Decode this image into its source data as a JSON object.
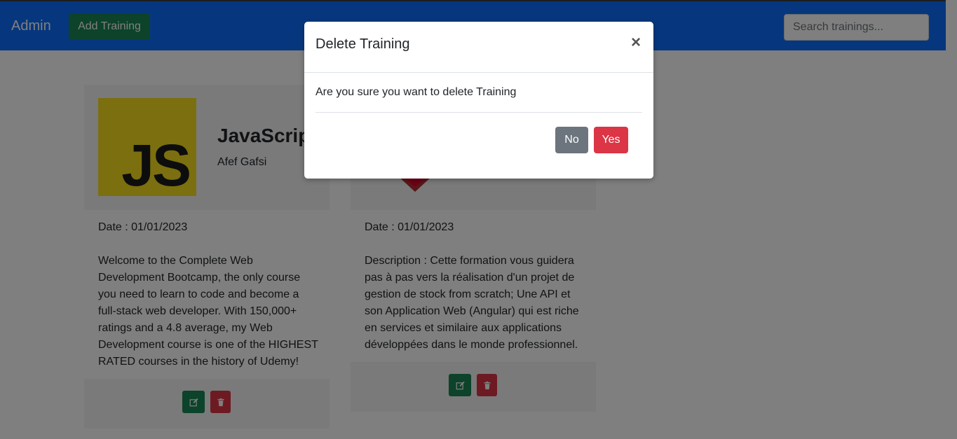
{
  "navbar": {
    "brand": "Admin",
    "add_button": "Add Training",
    "search_placeholder": "Search trainings..."
  },
  "trainings": [
    {
      "logo_text": "JS",
      "title": "JavaScript",
      "author": "Afef Gafsi",
      "date": "Date : 01/01/2023",
      "description": "Welcome to the Complete Web Development Bootcamp, the only course you need to learn to code and become a full-stack web developer. With 150,000+ ratings and a 4.8 average, my Web Development course is one of the HIGHEST RATED courses in the history of Udemy!"
    },
    {
      "date": "Date : 01/01/2023",
      "description": "Description : Cette formation vous guidera pas à pas vers la réalisation d'un projet de gestion de stock from scratch; Une API et son Application Web (Angular) qui est riche en services et similaire aux applications développées dans le monde professionnel."
    }
  ],
  "modal": {
    "title": "Delete Training",
    "close": "×",
    "message": "Are you sure you want to delete Training",
    "no_label": "No",
    "yes_label": "Yes"
  },
  "icons": {
    "edit": "edit-icon",
    "delete": "trash-icon",
    "close": "close-icon",
    "angular_logo": "angular-logo"
  },
  "colors": {
    "navbar": "#0d6efd",
    "success": "#198754",
    "danger": "#dc3545",
    "secondary": "#6c757d",
    "js_yellow": "#f7df1e",
    "angular_red": "#dd0031"
  }
}
